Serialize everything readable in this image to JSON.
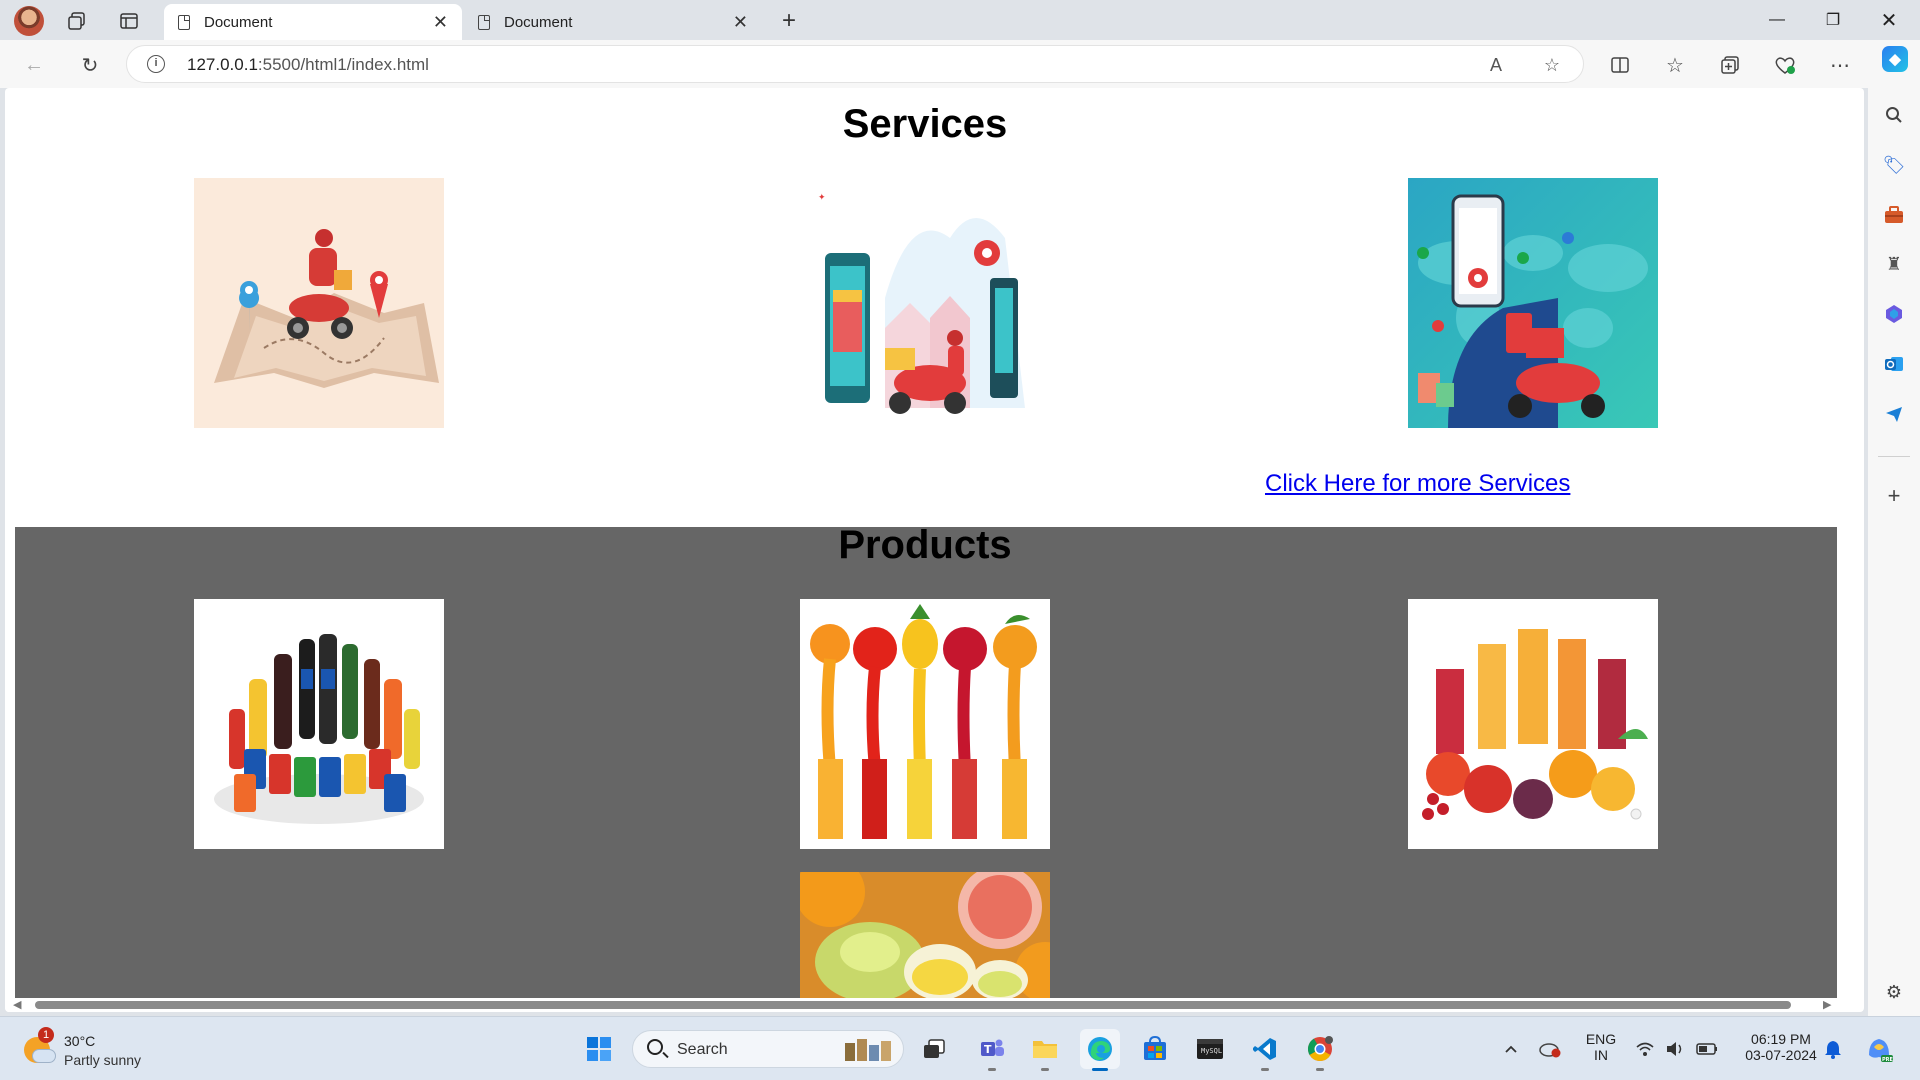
{
  "browser": {
    "tabs": [
      {
        "label": "Document",
        "active": true
      },
      {
        "label": "Document",
        "active": false
      }
    ],
    "new_tab": "+",
    "address": {
      "host": "127.0.0.1",
      "path": ":5500/html1/index.html"
    }
  },
  "page": {
    "services_title": "Services",
    "services_images": [
      "delivery-scooter-on-map-illustration",
      "online-food-delivery-illustration",
      "phone-map-scooter-delivery-illustration"
    ],
    "more_link": "Click Here for more Services",
    "products_title": "Products",
    "products_images": [
      "soft-drink-bottles-photo",
      "fruit-juice-splash-glasses-photo",
      "juice-glasses-with-fruits-photo",
      "citrus-juicer-photo"
    ]
  },
  "colors": {
    "products_bg": "#666666",
    "link": "#0000ee",
    "services_img1_bg": "#fbeadb",
    "services_img3_bg": "#2fbdc4"
  },
  "taskbar": {
    "weather": {
      "temp": "30°C",
      "condition": "Partly sunny",
      "badge": "1"
    },
    "search_label": "Search",
    "tray": {
      "lang1": "ENG",
      "lang2": "IN",
      "time": "06:19 PM",
      "date": "03-07-2024"
    }
  }
}
